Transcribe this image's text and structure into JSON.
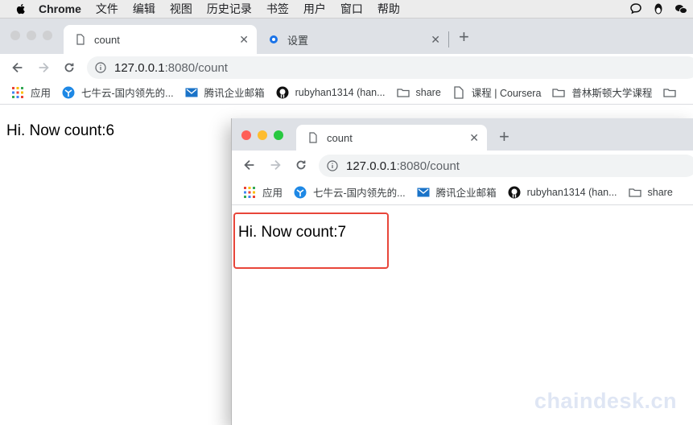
{
  "menubar": {
    "app_name": "Chrome",
    "menus": [
      "文件",
      "编辑",
      "视图",
      "历史记录",
      "书签",
      "用户",
      "窗口",
      "帮助"
    ]
  },
  "back_window": {
    "tabs": [
      {
        "title": "count",
        "icon": "page-icon"
      },
      {
        "title": "设置",
        "icon": "settings-gear-icon"
      }
    ],
    "url": {
      "host": "127.0.0.1",
      "path": ":8080/count"
    },
    "bookmarks": [
      {
        "label": "应用",
        "icon": "apps-grid-icon"
      },
      {
        "label": "七牛云-国内领先的...",
        "icon": "qiniu-icon"
      },
      {
        "label": "腾讯企业邮箱",
        "icon": "tencent-mail-icon"
      },
      {
        "label": "rubyhan1314 (han...",
        "icon": "github-icon"
      },
      {
        "label": "share",
        "icon": "folder-icon"
      },
      {
        "label": "课程 | Coursera",
        "icon": "page-icon"
      },
      {
        "label": "普林斯顿大学课程",
        "icon": "folder-icon"
      }
    ],
    "content_text": "Hi. Now count:6"
  },
  "front_window": {
    "tab": {
      "title": "count",
      "icon": "page-icon"
    },
    "url": {
      "host": "127.0.0.1",
      "path": ":8080/count"
    },
    "bookmarks": [
      {
        "label": "应用"
      },
      {
        "label": "七牛云-国内领先的..."
      },
      {
        "label": "腾讯企业邮箱"
      },
      {
        "label": "rubyhan1314 (han..."
      },
      {
        "label": "share"
      }
    ],
    "content_text": "Hi. Now count:7"
  },
  "watermark": "chaindesk.cn",
  "colors": {
    "highlight": "#e8463a",
    "tabstrip": "#dee1e6"
  }
}
